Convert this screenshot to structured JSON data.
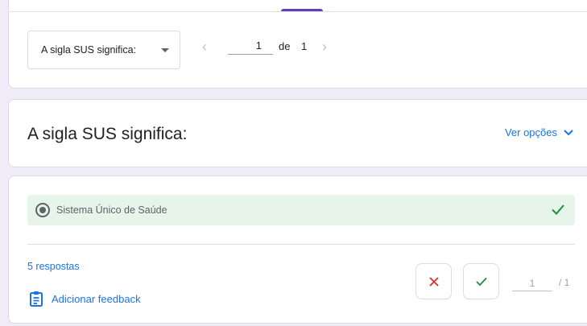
{
  "nav": {
    "question_select": "A sigla SUS significa:",
    "prev_icon": "chevron-left-icon",
    "next_icon": "chevron-right-icon",
    "page_current": "1",
    "page_of": "de",
    "page_total": "1"
  },
  "question": {
    "title": "A sigla SUS significa:",
    "ver_opcoes": "Ver opções"
  },
  "answer": {
    "option_text": "Sistema Único de Saúde",
    "is_correct": true,
    "responses": "5 respostas",
    "add_feedback": "Adicionar feedback",
    "score": "1",
    "score_max": "/ 1"
  },
  "colors": {
    "accent": "#673ab7",
    "link": "#1a73e8",
    "correct_bg": "#e6f4ea",
    "correct": "#1e8e3e",
    "incorrect": "#d93025"
  }
}
